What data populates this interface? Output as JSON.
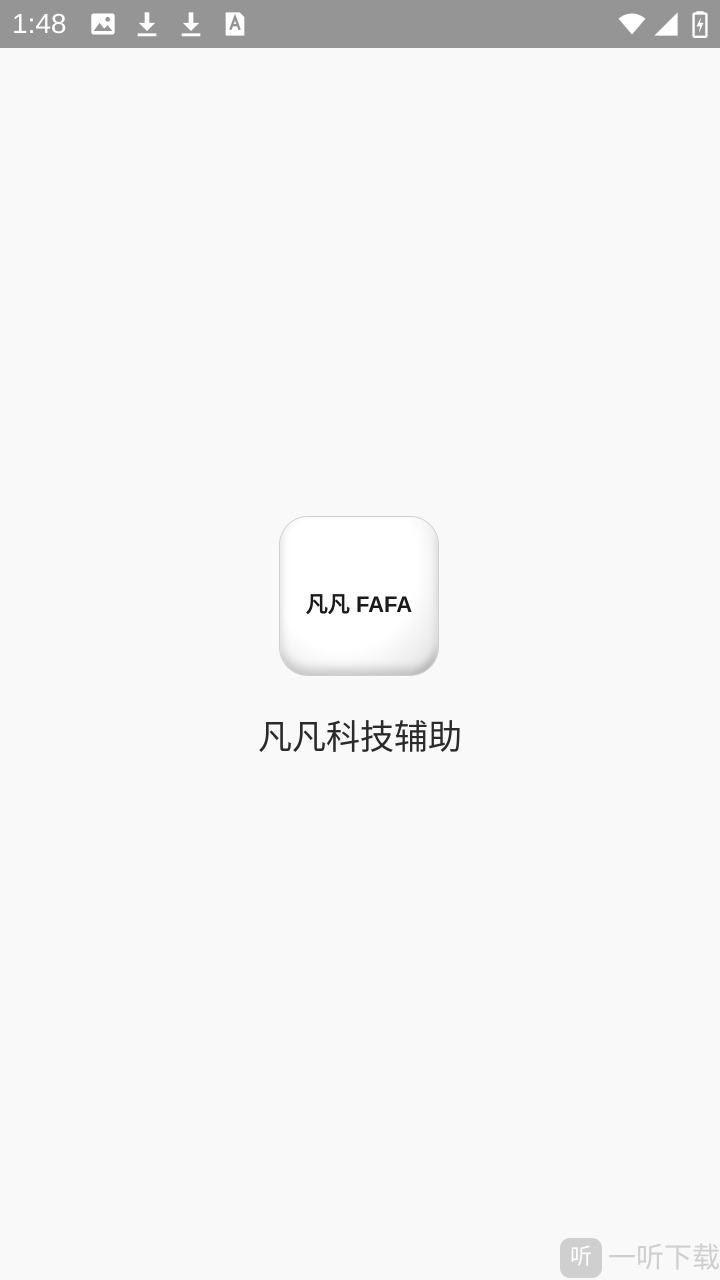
{
  "status_bar": {
    "time": "1:48",
    "left_icons": [
      "image-icon",
      "download-icon",
      "download-icon",
      "font-icon"
    ],
    "right_icons": [
      "wifi-icon",
      "signal-icon",
      "battery-charging-icon"
    ]
  },
  "splash": {
    "logo_text": "凡凡 FAFA",
    "app_name": "凡凡科技辅助"
  },
  "watermark": {
    "badge": "听",
    "text": "一听下载"
  },
  "colors": {
    "status_bar": "#959595",
    "background": "#f9f9f9",
    "title_text": "#2a2a2a",
    "watermark": "#cfcfcf"
  }
}
